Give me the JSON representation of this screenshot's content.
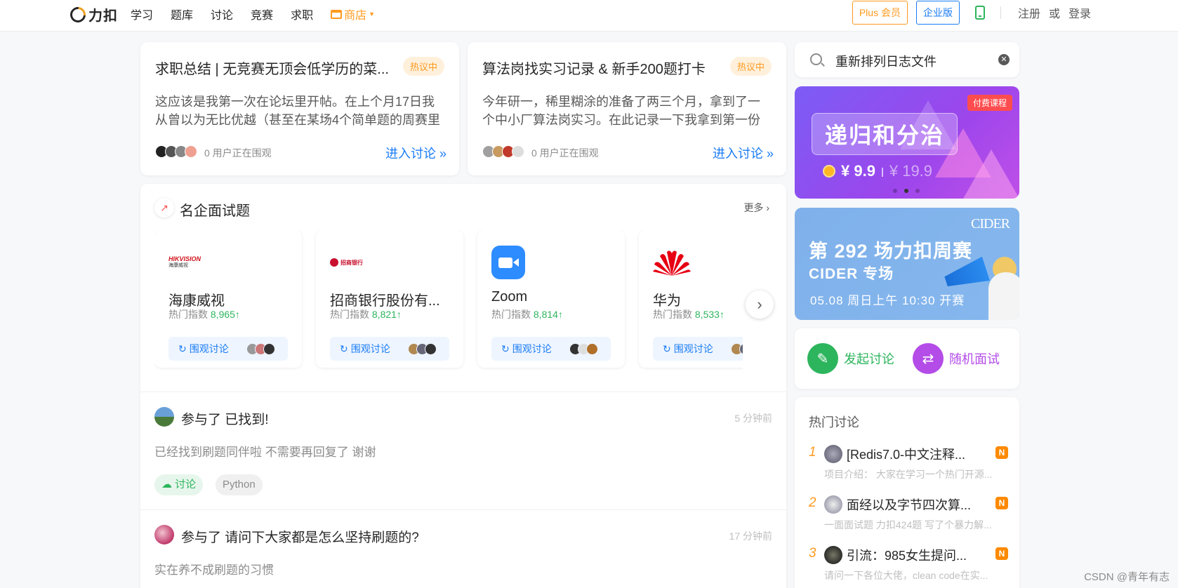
{
  "header": {
    "logo_text": "力扣",
    "nav": [
      "学习",
      "题库",
      "讨论",
      "竞赛",
      "求职"
    ],
    "store_label": "商店",
    "plus_label": "Plus 会员",
    "enterprise_label": "企业版",
    "register": "注册",
    "or": "或",
    "login": "登录"
  },
  "featured": [
    {
      "title": "求职总结 | 无竞赛无顶会低学历的菜...",
      "badge": "热议中",
      "excerpt": "这应该是我第一次在论坛里开帖。在上个月17日我从曾以为无比优越（甚至在某场4个简单题的周赛里发...",
      "watchers": "0 用户正在围观",
      "link": "进入讨论 »",
      "avatar_colors": [
        "#222",
        "#444",
        "#777",
        "#f0a090"
      ]
    },
    {
      "title": "算法岗找实习记录 & 新手200题打卡",
      "badge": "热议中",
      "excerpt": "今年研一，稀里糊涂的准备了两三个月，拿到了一个中小厂算法岗实习。在此记录一下我拿到第一份实...",
      "watchers": "0 用户正在围观",
      "link": "进入讨论 »",
      "avatar_colors": [
        "#a0a0a0",
        "#c89a60",
        "#c0392b",
        "#ddd"
      ]
    }
  ],
  "companies_section": {
    "title": "名企面试题",
    "more": "更多",
    "index_label": "热门指数",
    "watch_label": "围观讨论",
    "items": [
      {
        "name": "海康威视",
        "index": "8,965↑"
      },
      {
        "name": "招商银行股份有...",
        "index": "8,821↑"
      },
      {
        "name": "Zoom",
        "index": "8,814↑"
      },
      {
        "name": "华为",
        "index": "8,533↑"
      }
    ],
    "logo_texts": {
      "hikvision": "HIKVISION",
      "hikvision_cn": "海康威视",
      "cmb": "招商银行"
    }
  },
  "activities": [
    {
      "title": "参与了 已找到!",
      "time": "5 分钟前",
      "text": "已经找到刷题同伴啦 不需要再回复了 谢谢",
      "tags": [
        "讨论",
        "Python"
      ]
    },
    {
      "title": "参与了 请问下大家都是怎么坚持刷题的?",
      "time": "17 分钟前",
      "text": "实在养不成刷题的习惯"
    }
  ],
  "search": {
    "value": "重新排列日志文件"
  },
  "banner_course": {
    "badge": "付费课程",
    "title": "递归和分治",
    "price": "¥ 9.9",
    "divider": "|",
    "old_price": "¥ 19.9"
  },
  "banner_contest": {
    "brand": "CIDER",
    "title": "第 292 场力扣周赛",
    "subtitle": "CIDER 专场",
    "date": "05.08 周日上午 10:30 开赛"
  },
  "quick_actions": {
    "start": "发起讨论",
    "random": "随机面试"
  },
  "hot_discussions": {
    "heading": "热门讨论",
    "new_badge": "N",
    "items": [
      {
        "rank": "1",
        "title": "[Redis7.0-中文注释...",
        "desc": "项目介绍： 大家在学习一个热门开源..."
      },
      {
        "rank": "2",
        "title": "面经以及字节四次算...",
        "desc": "一面面试题 力扣424题 写了个暴力解..."
      },
      {
        "rank": "3",
        "title": "引流：985女生提问...",
        "desc": "请问一下各位大佬，clean code在实..."
      }
    ]
  },
  "watermark": "CSDN @青年有志",
  "colors": {
    "brand_orange": "#ff9a1f",
    "link_blue": "#1a7cf5",
    "green": "#2db55d",
    "purple": "#b44ce8"
  }
}
